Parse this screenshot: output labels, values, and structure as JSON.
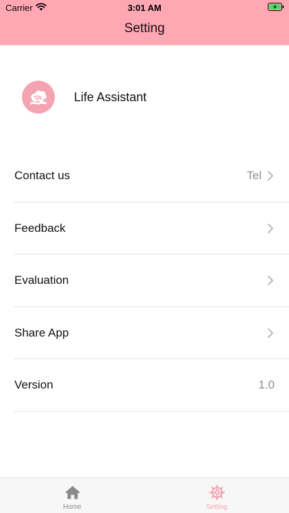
{
  "status_bar": {
    "carrier": "Carrier",
    "time": "3:01 AM"
  },
  "header": {
    "title": "Setting"
  },
  "app": {
    "name": "Life Assistant"
  },
  "settings": [
    {
      "label": "Contact us",
      "value": "Tel",
      "chevron": true
    },
    {
      "label": "Feedback",
      "value": "",
      "chevron": true
    },
    {
      "label": "Evaluation",
      "value": "",
      "chevron": true
    },
    {
      "label": "Share App",
      "value": "",
      "chevron": true
    },
    {
      "label": "Version",
      "value": "1.0",
      "chevron": false
    }
  ],
  "tab_bar": {
    "tabs": [
      {
        "label": "Home",
        "icon": "home-icon",
        "selected": false
      },
      {
        "label": "Setting",
        "icon": "gear-icon",
        "selected": true
      }
    ]
  },
  "colors": {
    "header_bg": "#FFA8B4",
    "accent": "#F4A3B1",
    "secondary_text": "#8E8E93"
  }
}
